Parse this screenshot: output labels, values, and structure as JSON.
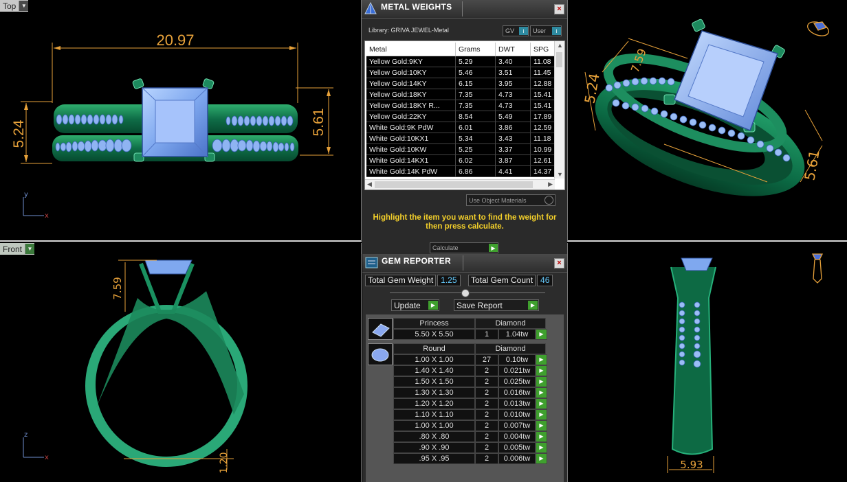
{
  "viewports": {
    "top": {
      "label": "Top",
      "dim_width": "20.97",
      "dim_left": "5.24",
      "dim_right": "5.61"
    },
    "front": {
      "label": "Front",
      "dim_height": "7.59",
      "dim_bottom": "1.20"
    },
    "perspective": {
      "dim_a": "7.59",
      "dim_b": "5.24",
      "dim_c": "5.61"
    },
    "right": {
      "dim_bottom": "5.93"
    },
    "axis_y": "y",
    "axis_x": "x",
    "axis_z": "z"
  },
  "metal_weights": {
    "title": "METAL WEIGHTS",
    "library_label": "Library: GRIVA JEWEL-Metal",
    "gv_label": "GV",
    "user_label": "User",
    "columns": [
      "Metal",
      "Grams",
      "DWT",
      "SPG"
    ],
    "rows": [
      [
        "Yellow Gold:9KY",
        "5.29",
        "3.40",
        "11.08"
      ],
      [
        "Yellow Gold:10KY",
        "5.46",
        "3.51",
        "11.45"
      ],
      [
        "Yellow Gold:14KY",
        "6.15",
        "3.95",
        "12.88"
      ],
      [
        "Yellow Gold:18KY",
        "7.35",
        "4.73",
        "15.41"
      ],
      [
        "Yellow Gold:18KY R...",
        "7.35",
        "4.73",
        "15.41"
      ],
      [
        "Yellow Gold:22KY",
        "8.54",
        "5.49",
        "17.89"
      ],
      [
        "White Gold:9K PdW",
        "6.01",
        "3.86",
        "12.59"
      ],
      [
        "White Gold:10KX1",
        "5.34",
        "3.43",
        "11.18"
      ],
      [
        "White Gold:10KW",
        "5.25",
        "3.37",
        "10.99"
      ],
      [
        "White Gold:14KX1",
        "6.02",
        "3.87",
        "12.61"
      ],
      [
        "White Gold:14K PdW",
        "6.86",
        "4.41",
        "14.37"
      ]
    ],
    "use_object_materials": "Use Object Materials",
    "message": "Highlight the item you want to find the weight for then press calculate.",
    "calculate_label": "Calculate"
  },
  "gem_reporter": {
    "title": "GEM REPORTER",
    "total_weight_label": "Total Gem Weight",
    "total_weight_value": "1.25",
    "total_count_label": "Total Gem Count",
    "total_count_value": "46",
    "update_label": "Update",
    "save_report_label": "Save Report",
    "groups": [
      {
        "shape": "Princess",
        "material": "Diamond",
        "rows": [
          [
            "5.50 X 5.50",
            "1",
            "1.04tw"
          ]
        ]
      },
      {
        "shape": "Round",
        "material": "Diamond",
        "rows": [
          [
            "1.00 X 1.00",
            "27",
            "0.10tw"
          ],
          [
            "1.40 X 1.40",
            "2",
            "0.021tw"
          ],
          [
            "1.50 X 1.50",
            "2",
            "0.025tw"
          ],
          [
            "1.30 X 1.30",
            "2",
            "0.016tw"
          ],
          [
            "1.20 X 1.20",
            "2",
            "0.013tw"
          ],
          [
            "1.10 X 1.10",
            "2",
            "0.010tw"
          ],
          [
            "1.00 X 1.00",
            "2",
            "0.007tw"
          ],
          [
            ".80 X .80",
            "2",
            "0.004tw"
          ],
          [
            ".90 X .90",
            "2",
            "0.005tw"
          ],
          [
            ".95 X .95",
            "2",
            "0.006tw"
          ]
        ]
      }
    ]
  }
}
